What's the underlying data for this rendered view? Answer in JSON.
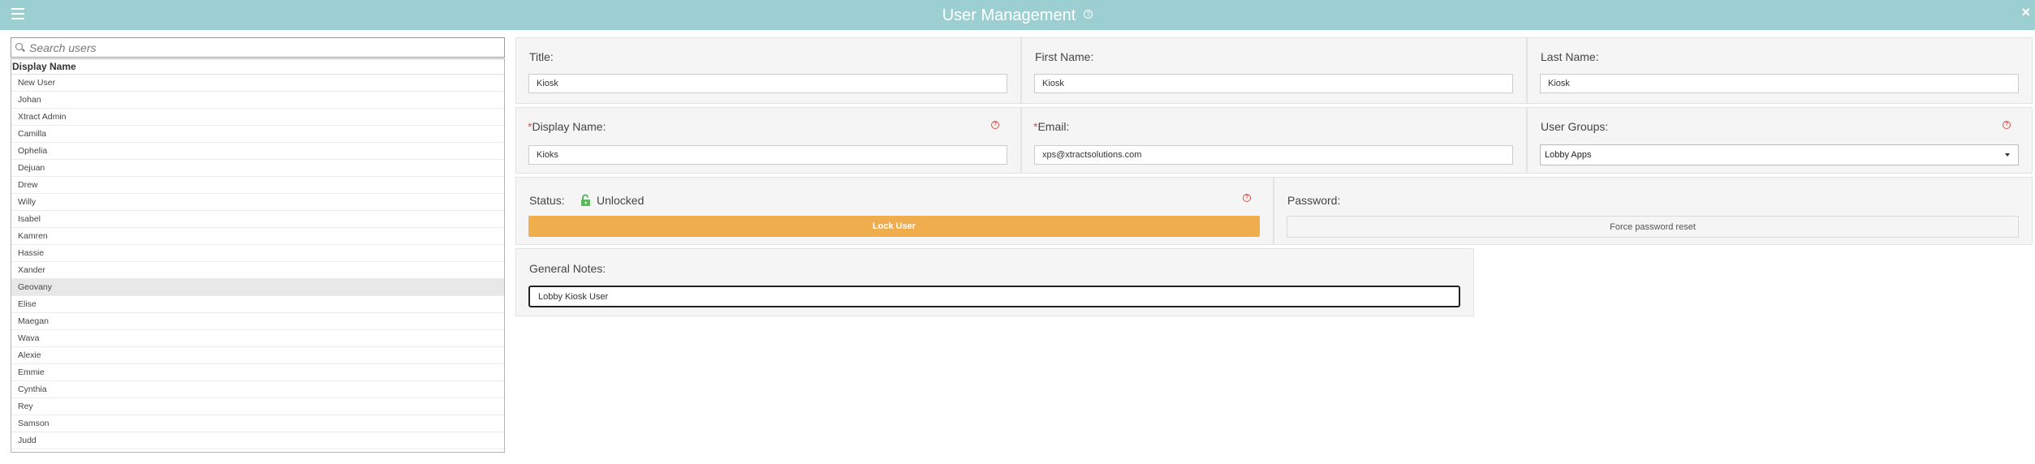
{
  "app": {
    "title": "User Management",
    "help_glyph": "?",
    "close_glyph": "×",
    "accent_color": "#9bcfd1"
  },
  "user_list": {
    "search_placeholder": "Search users",
    "column_header": "Display Name",
    "selected_index": 12,
    "users": [
      "New User",
      "Johan",
      "Xtract Admin",
      "Camilla",
      "Ophelia",
      "Dejuan",
      "Drew",
      "Willy",
      "Isabel",
      "Kamren",
      "Hassie",
      "Xander",
      "Geovany",
      "Elise",
      "Maegan",
      "Wava",
      "Alexie",
      "Emmie",
      "Cynthia",
      "Rey",
      "Samson",
      "Judd"
    ]
  },
  "form": {
    "title_label": "Title:",
    "title_value": "Kiosk",
    "first_name_label": "First Name:",
    "first_name_value": "Kiosk",
    "last_name_label": "Last Name:",
    "last_name_value": "Kiosk",
    "required_marker": "*",
    "display_name_label": "Display Name:",
    "display_name_value": "Kioks",
    "email_label": "Email:",
    "email_value": "xps@xtractsolutions.com",
    "user_groups_label": "User Groups:",
    "user_groups_value": "Lobby Apps",
    "help_glyph": "?",
    "status_label": "Status:",
    "status_value": "Unlocked",
    "status_icon": "unlocked-padlock-icon",
    "lock_button": "Lock User",
    "password_label": "Password:",
    "reset_button": "Force password reset",
    "notes_label": "General Notes:",
    "notes_value": "Lobby Kiosk User"
  }
}
